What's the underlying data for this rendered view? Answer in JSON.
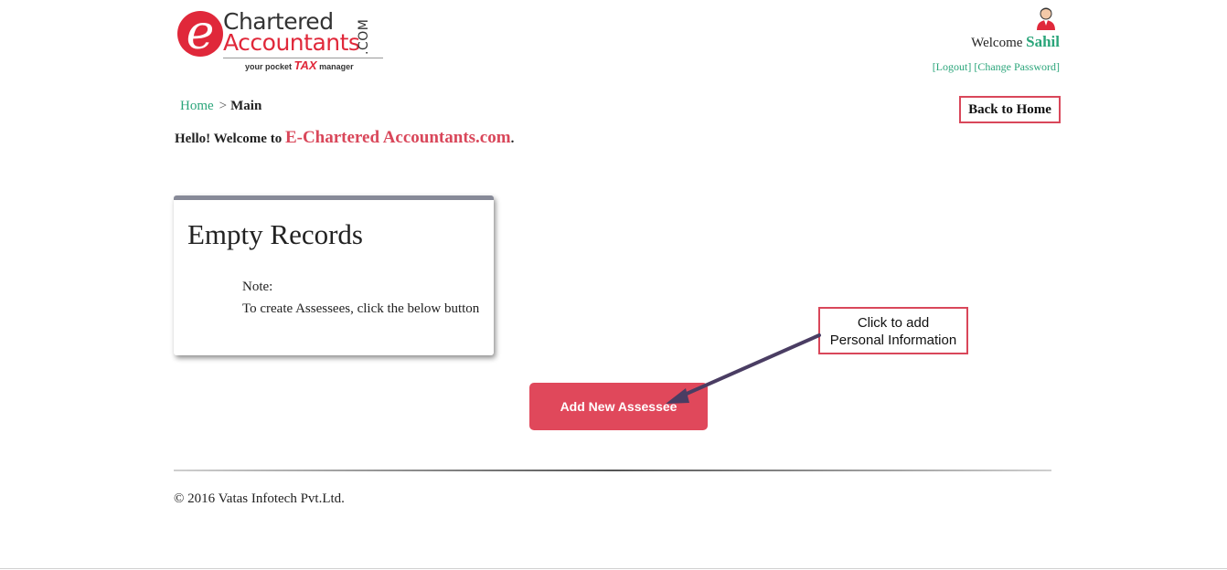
{
  "logo": {
    "e_letter": "e",
    "line1": "Chartered",
    "line2": "Accountants",
    "com": ".COM",
    "tag_pre": "your pocket ",
    "tag_tax": "TAX",
    "tag_post": " manager"
  },
  "user": {
    "welcome_label": "Welcome",
    "name": "Sahil",
    "logout_label": "[Logout]",
    "change_password_label": "[Change Password]",
    "icon": "user-avatar-icon"
  },
  "breadcrumb": {
    "home": "Home",
    "separator": ">",
    "current": "Main"
  },
  "back_to_home_label": "Back to Home",
  "hello": {
    "prefix": "Hello! Welcome to",
    "brand": "E-Chartered Accountants.com",
    "suffix": "."
  },
  "card": {
    "title": "Empty Records",
    "note_label": "Note:",
    "note_text": "To create Assessees, click the below button"
  },
  "add_button_label": "Add New Assessee",
  "callout": {
    "line1": "Click to add",
    "line2": "Personal Information"
  },
  "footer": {
    "copyright": "© 2016 Vatas Infotech Pvt.Ltd."
  },
  "colors": {
    "accent_red": "#e0485b",
    "link_green": "#2aa57a",
    "callout_border": "#d9475a"
  }
}
